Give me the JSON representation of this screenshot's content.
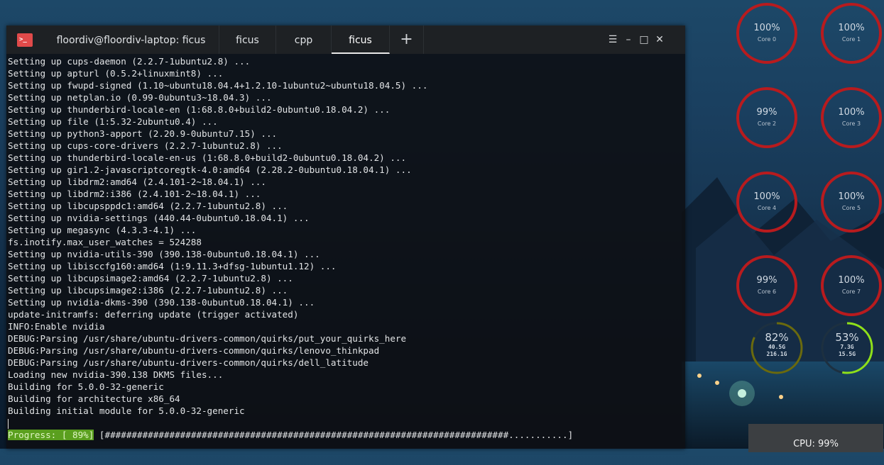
{
  "terminal": {
    "tabs": [
      {
        "label": "floordiv@floordiv-laptop: ficus"
      },
      {
        "label": "ficus"
      },
      {
        "label": "cpp"
      },
      {
        "label": "ficus"
      }
    ],
    "app_icon": ">_",
    "new_tab_symbol": "+",
    "window_controls": {
      "menu": "☰",
      "minimize": "–",
      "maximize": "□",
      "close": "✕"
    },
    "lines": [
      "Setting up cups-daemon (2.2.7-1ubuntu2.8) ...",
      "Setting up apturl (0.5.2+linuxmint8) ...",
      "Setting up fwupd-signed (1.10~ubuntu18.04.4+1.2.10-1ubuntu2~ubuntu18.04.5) ...",
      "Setting up netplan.io (0.99-0ubuntu3~18.04.3) ...",
      "Setting up thunderbird-locale-en (1:68.8.0+build2-0ubuntu0.18.04.2) ...",
      "Setting up file (1:5.32-2ubuntu0.4) ...",
      "Setting up python3-apport (2.20.9-0ubuntu7.15) ...",
      "Setting up cups-core-drivers (2.2.7-1ubuntu2.8) ...",
      "Setting up thunderbird-locale-en-us (1:68.8.0+build2-0ubuntu0.18.04.2) ...",
      "Setting up gir1.2-javascriptcoregtk-4.0:amd64 (2.28.2-0ubuntu0.18.04.1) ...",
      "Setting up libdrm2:amd64 (2.4.101-2~18.04.1) ...",
      "Setting up libdrm2:i386 (2.4.101-2~18.04.1) ...",
      "Setting up libcupsppdc1:amd64 (2.2.7-1ubuntu2.8) ...",
      "Setting up nvidia-settings (440.44-0ubuntu0.18.04.1) ...",
      "Setting up megasync (4.3.3-4.1) ...",
      "fs.inotify.max_user_watches = 524288",
      "Setting up nvidia-utils-390 (390.138-0ubuntu0.18.04.1) ...",
      "Setting up libisccfg160:amd64 (1:9.11.3+dfsg-1ubuntu1.12) ...",
      "Setting up libcupsimage2:amd64 (2.2.7-1ubuntu2.8) ...",
      "Setting up libcupsimage2:i386 (2.2.7-1ubuntu2.8) ...",
      "Setting up nvidia-dkms-390 (390.138-0ubuntu0.18.04.1) ...",
      "update-initramfs: deferring update (trigger activated)",
      "INFO:Enable nvidia",
      "DEBUG:Parsing /usr/share/ubuntu-drivers-common/quirks/put_your_quirks_here",
      "DEBUG:Parsing /usr/share/ubuntu-drivers-common/quirks/lenovo_thinkpad",
      "DEBUG:Parsing /usr/share/ubuntu-drivers-common/quirks/dell_latitude",
      "Loading new nvidia-390.138 DKMS files...",
      "Building for 5.0.0-32-generic",
      "Building for architecture x86_64",
      "Building initial module for 5.0.0-32-generic"
    ],
    "progress": {
      "label": "Progress: [ 89%]",
      "bar": "[###########################################################################...........]",
      "fraction": 0.89
    }
  },
  "widgets": {
    "cores": [
      {
        "percent": "100%",
        "label": "Core 0"
      },
      {
        "percent": "100%",
        "label": "Core 1"
      },
      {
        "percent": "99%",
        "label": "Core 2"
      },
      {
        "percent": "100%",
        "label": "Core 3"
      },
      {
        "percent": "100%",
        "label": "Core 4"
      },
      {
        "percent": "100%",
        "label": "Core 5"
      },
      {
        "percent": "99%",
        "label": "Core 6"
      },
      {
        "percent": "100%",
        "label": "Core 7"
      }
    ],
    "disk": {
      "percent": "82%",
      "used": "40.5G",
      "total": "216.1G",
      "fraction": 0.82,
      "color": "#6a6a0e"
    },
    "memory": {
      "percent": "53%",
      "used": "7.3G",
      "total": "15.5G",
      "fraction": 0.53,
      "color": "#8fe01a"
    },
    "cpu_panel": {
      "label": "CPU: 99%"
    },
    "colors": {
      "core_ring": "#b81b1e"
    }
  }
}
